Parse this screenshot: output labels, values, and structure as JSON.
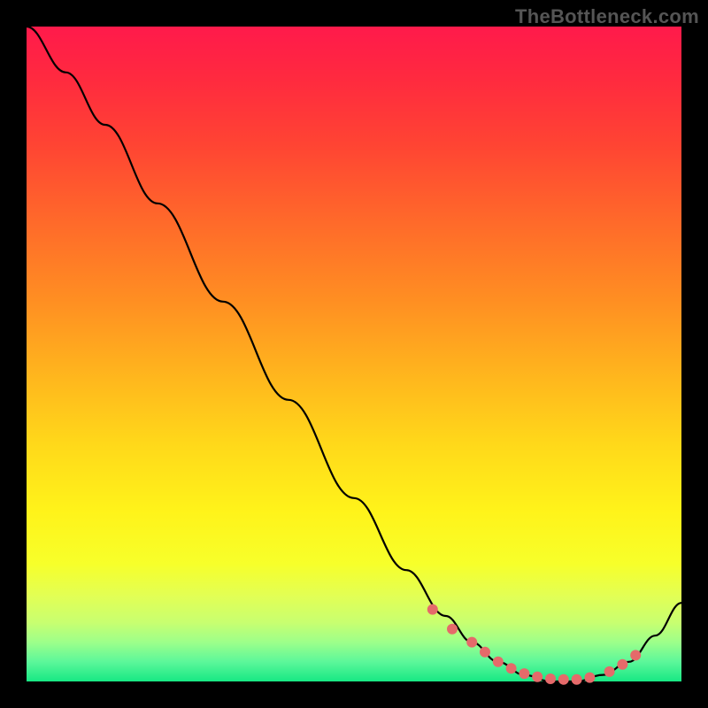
{
  "watermark": "TheBottleneck.com",
  "chart_data": {
    "type": "line",
    "title": "",
    "xlabel": "",
    "ylabel": "",
    "xlim": [
      0,
      100
    ],
    "ylim": [
      0,
      100
    ],
    "grid": false,
    "legend": false,
    "series": [
      {
        "name": "bottleneck-curve",
        "color": "#000000",
        "x": [
          0,
          6,
          12,
          20,
          30,
          40,
          50,
          58,
          64,
          68,
          72,
          76,
          80,
          84,
          88,
          92,
          96,
          100
        ],
        "y": [
          100,
          93,
          85,
          73,
          58,
          43,
          28,
          17,
          10,
          6,
          3,
          1,
          0,
          0,
          1,
          3,
          7,
          12
        ]
      }
    ],
    "markers": {
      "name": "highlight-dots",
      "color": "#e56a6a",
      "radius": 6,
      "x": [
        62,
        65,
        68,
        70,
        72,
        74,
        76,
        78,
        80,
        82,
        84,
        86,
        89,
        91,
        93
      ],
      "y": [
        11,
        8,
        6,
        4.5,
        3,
        2,
        1.2,
        0.7,
        0.4,
        0.3,
        0.3,
        0.6,
        1.5,
        2.6,
        4
      ]
    }
  }
}
